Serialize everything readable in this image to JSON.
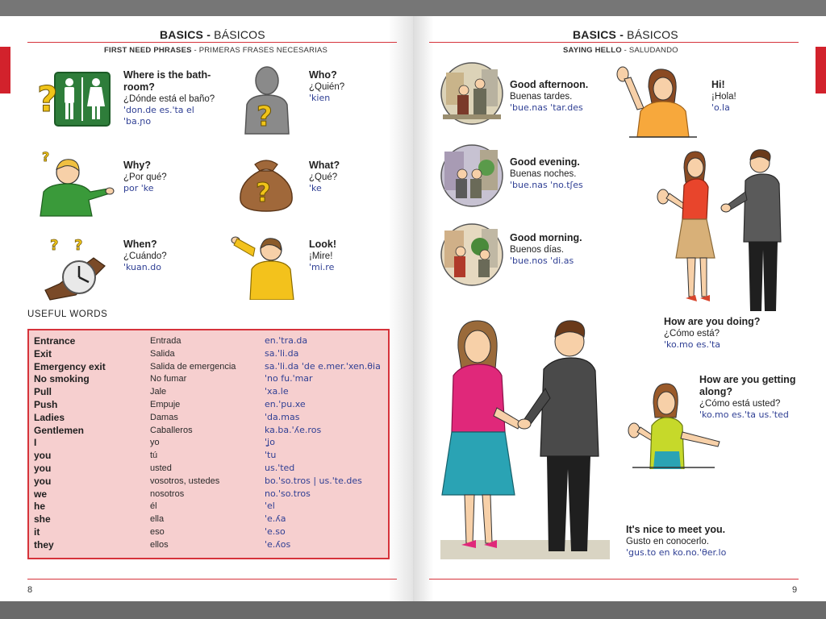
{
  "left_page": {
    "title_en": "BASICS",
    "title_sep": " - ",
    "title_es": "BÁSICOS",
    "subtitle_en": "FIRST NEED PHRASES",
    "subtitle_sep": " - ",
    "subtitle_es": "PRIMERAS FRASES NECESARIAS",
    "phrases": [
      {
        "en": "Where is the bath-room?",
        "es": "¿Dónde está el baño?",
        "ph": "'don.de es.'ta el 'ba.ɲo"
      },
      {
        "en": "Who?",
        "es": "¿Quién?",
        "ph": "'kien"
      },
      {
        "en": "Why?",
        "es": "¿Por qué?",
        "ph": "por 'ke"
      },
      {
        "en": "What?",
        "es": "¿Qué?",
        "ph": "'ke"
      },
      {
        "en": "When?",
        "es": "¿Cuándo?",
        "ph": "'kuan.do"
      },
      {
        "en": "Look!",
        "es": "¡Mire!",
        "ph": "'mi.re"
      }
    ],
    "useful_words_heading": "USEFUL WORDS",
    "words": [
      {
        "en": "Entrance",
        "es": "Entrada",
        "ph": "en.'tra.da"
      },
      {
        "en": "Exit",
        "es": "Salida",
        "ph": "sa.'li.da"
      },
      {
        "en": "Emergency exit",
        "es": "Salida de emergencia",
        "ph": "sa.'li.da 'de e.mer.'xen.θia"
      },
      {
        "en": "No smoking",
        "es": "No fumar",
        "ph": "'no fu.'mar"
      },
      {
        "en": "Pull",
        "es": "Jale",
        "ph": "'xa.le"
      },
      {
        "en": "Push",
        "es": "Empuje",
        "ph": "en.'pu.xe"
      },
      {
        "en": "Ladies",
        "es": "Damas",
        "ph": "'da.mas"
      },
      {
        "en": "Gentlemen",
        "es": "Caballeros",
        "ph": "ka.ba.'ʎe.ros"
      },
      {
        "en": "I",
        "es": "yo",
        "ph": "'ʝo"
      },
      {
        "en": "you",
        "es": "tú",
        "ph": "'tu"
      },
      {
        "en": "you",
        "es": "usted",
        "ph": "us.'ted"
      },
      {
        "en": "you",
        "es": "vosotros, ustedes",
        "ph": "bo.'so.tros | us.'te.des"
      },
      {
        "en": "we",
        "es": "nosotros",
        "ph": "no.'so.tros"
      },
      {
        "en": "he",
        "es": "él",
        "ph": "'el"
      },
      {
        "en": "she",
        "es": "ella",
        "ph": "'e.ʎa"
      },
      {
        "en": "it",
        "es": "eso",
        "ph": "'e.so"
      },
      {
        "en": "they",
        "es": "ellos",
        "ph": "'e.ʎos"
      }
    ],
    "page_number": "8"
  },
  "right_page": {
    "title_en": "BASICS",
    "title_sep": " - ",
    "title_es": "BÁSICOS",
    "subtitle_en": "SAYING HELLO",
    "subtitle_sep": " - ",
    "subtitle_es": "SALUDANDO",
    "phrases": [
      {
        "en": "Good afternoon.",
        "es": "Buenas tardes.",
        "ph": "'bue.nas 'tar.des"
      },
      {
        "en": "Hi!",
        "es": "¡Hola!",
        "ph": "'o.la"
      },
      {
        "en": "Good evening.",
        "es": "Buenas noches.",
        "ph": "'bue.nas 'no.tʃes"
      },
      {
        "en": "Good morning.",
        "es": "Buenos días.",
        "ph": "'bue.nos 'di.as"
      },
      {
        "en": "How are you doing?",
        "es": "¿Cómo está?",
        "ph": "'ko.mo es.'ta"
      },
      {
        "en": "How are you getting along?",
        "es": "¿Cómo está usted?",
        "ph": "'ko.mo es.'ta us.'ted"
      },
      {
        "en": "It's nice to meet you.",
        "es": "Gusto en conocerlo.",
        "ph": "'gus.to en ko.no.'θer.lo"
      }
    ],
    "page_number": "9"
  },
  "colors": {
    "accent": "#d6333b",
    "phonetic": "#2f3f94",
    "word_box": "#f6cfcf"
  }
}
